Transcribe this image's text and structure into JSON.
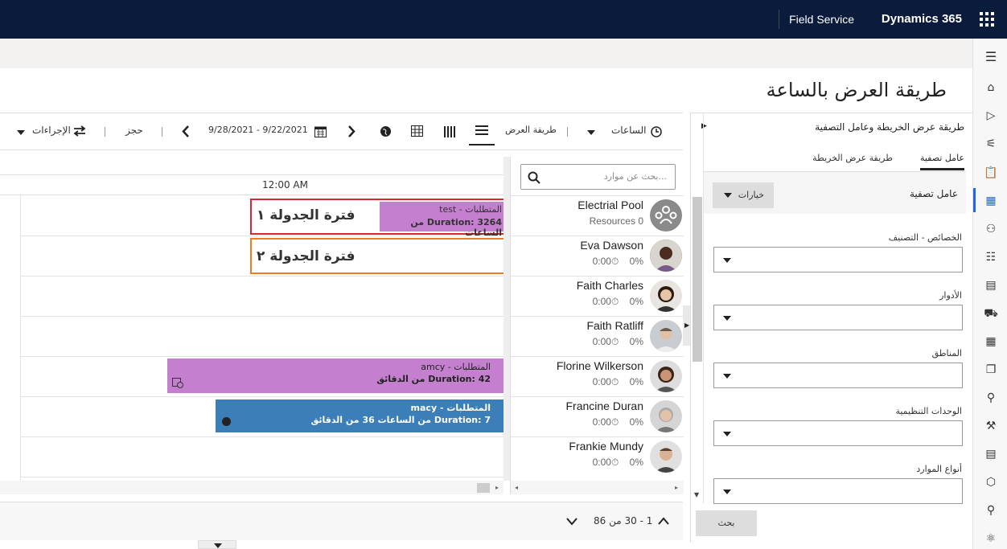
{
  "topbar": {
    "brand": "Dynamics 365",
    "app": "Field Service"
  },
  "page": {
    "title": "طريقة العرض بالساعة"
  },
  "toolbar": {
    "hours": "الساعات",
    "view": "طريقة العرض",
    "date_range": "9/28/2021 - 9/22/2021",
    "book": "حجز",
    "actions": "الإجراءات"
  },
  "timeline": {
    "hour": "12:00 AM",
    "bookings": [
      {
        "title": "المتطلبات - test",
        "duration": "Duration: 3264 من الساعات"
      },
      {
        "title": "المتطلبات - amcy",
        "duration": "Duration: 42 من الدقائق"
      },
      {
        "title": "المتطلبات - macy",
        "duration": "Duration: 7 من الساعات 36 من الدقائق"
      }
    ],
    "callouts": {
      "slot1": "فترة الجدولة ١",
      "slot2": "فترة الجدولة ٢"
    }
  },
  "resources": {
    "search_placeholder": "بحث عن موارد...",
    "items": [
      {
        "name": "Electrial Pool",
        "sub": "Resources 0"
      },
      {
        "name": "Eva Dawson",
        "pct": "0%",
        "time": "0:00"
      },
      {
        "name": "Faith Charles",
        "pct": "0%",
        "time": "0:00"
      },
      {
        "name": "Faith Ratliff",
        "pct": "0%",
        "time": "0:00"
      },
      {
        "name": "Florine Wilkerson",
        "pct": "0%",
        "time": "0:00"
      },
      {
        "name": "Francine Duran",
        "pct": "0%",
        "time": "0:00"
      },
      {
        "name": "Frankie Mundy",
        "pct": "0%",
        "time": "0:00"
      }
    ]
  },
  "pagination": {
    "text": "1 - 30 من 86"
  },
  "filter": {
    "title": "طريقة عرض الخريطة وعامل التصفية",
    "tab_filter": "عامل تصفية",
    "tab_map": "طريقة عرض الخريطة",
    "section": "عامل تصفية",
    "options": "خيارات",
    "fields": [
      "الخصائص - التصنيف",
      "الأدوار",
      "المناطق",
      "الوحدات التنظيمية",
      "أنواع الموارد"
    ],
    "search_button": "بحث"
  },
  "colors": {
    "accent": "#2266e3",
    "booking_purple": "#c57fcf",
    "booking_blue": "#3c7fb8",
    "callout_red": "#d9262f",
    "callout_orange": "#f07c22"
  }
}
